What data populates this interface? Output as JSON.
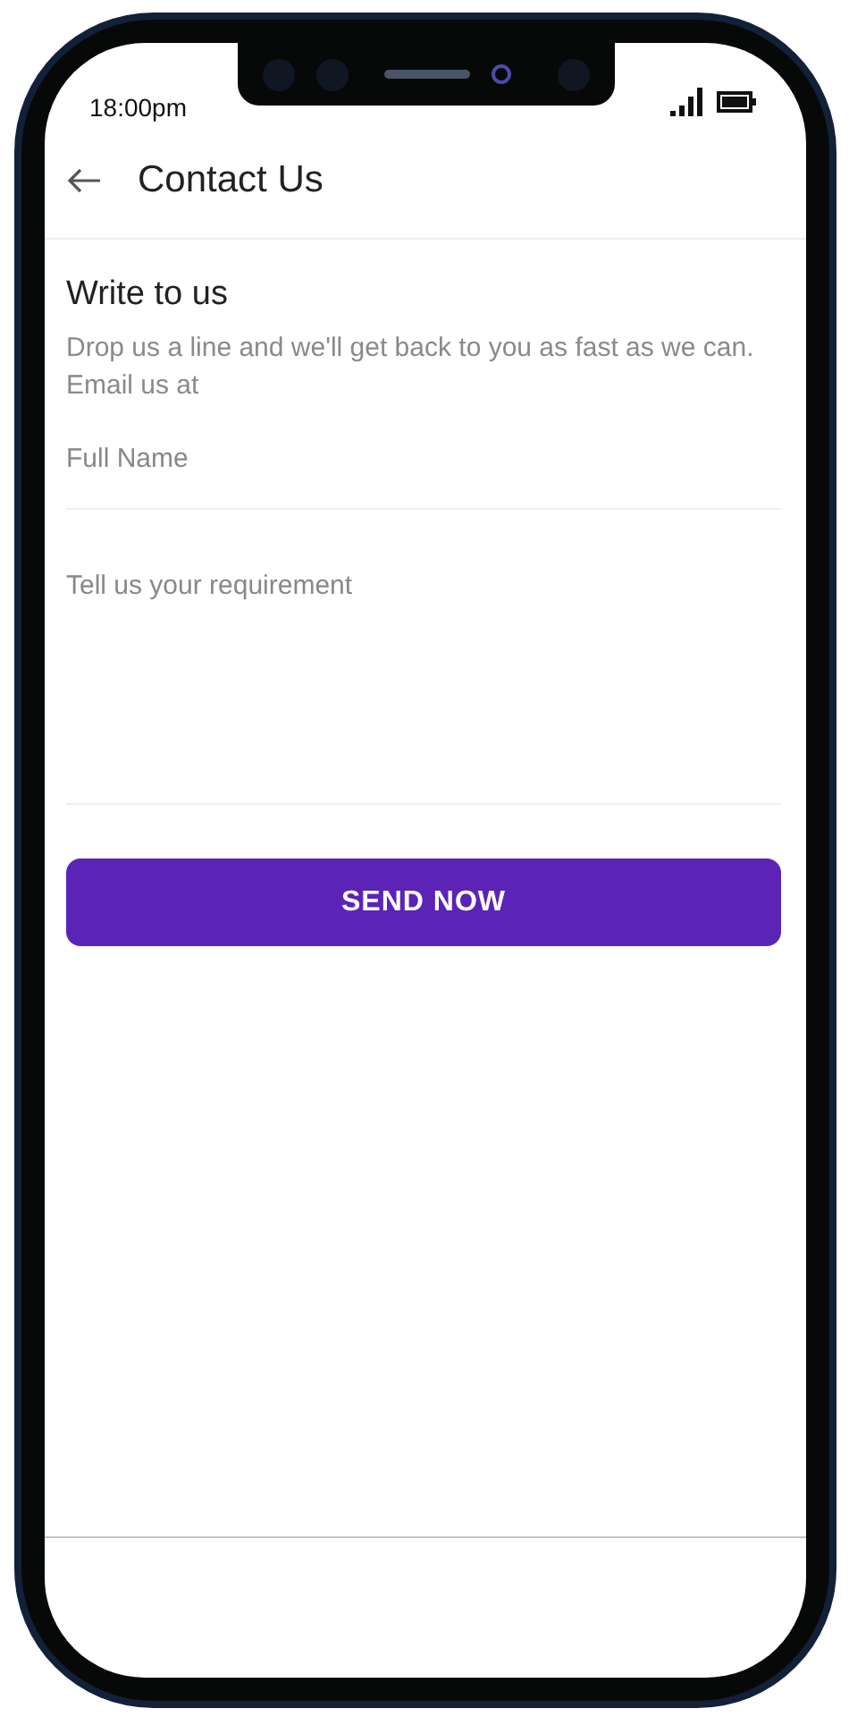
{
  "status_bar": {
    "time": "18:00pm"
  },
  "header": {
    "title": "Contact Us"
  },
  "intro": {
    "title": "Write to us",
    "description": "Drop us a line and we'll get back to you as fast as we can. Email us at"
  },
  "fields": [
    {
      "kind": "input",
      "placeholder": "Full Name"
    },
    {
      "kind": "textarea",
      "placeholder": "Tell us your requirement"
    }
  ],
  "submit_button": {
    "label": "SEND NOW"
  }
}
